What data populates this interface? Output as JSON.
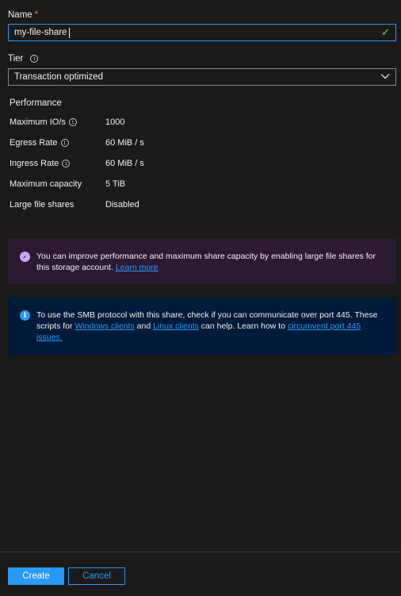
{
  "name_field": {
    "label": "Name",
    "required_marker": "*",
    "value": "my-file-share",
    "valid_icon": "checkmark-icon"
  },
  "tier_field": {
    "label": "Tier",
    "info_icon": "info-icon",
    "selected": "Transaction optimized",
    "dropdown_icon": "chevron-down-icon"
  },
  "performance": {
    "title": "Performance",
    "rows": [
      {
        "label": "Maximum IO/s",
        "value": "1000",
        "has_info": true
      },
      {
        "label": "Egress Rate",
        "value": "60 MiB / s",
        "has_info": true
      },
      {
        "label": "Ingress Rate",
        "value": "60 MiB / s",
        "has_info": true
      },
      {
        "label": "Maximum capacity",
        "value": "5 TiB",
        "has_info": false
      },
      {
        "label": "Large file shares",
        "value": "Disabled",
        "has_info": false
      }
    ]
  },
  "notice_large_shares": {
    "icon": "rocket-icon",
    "text": "You can improve performance and maximum share capacity by enabling large file shares for this storage account.",
    "link": "Learn more",
    "color": "#2a1a34"
  },
  "notice_smb": {
    "icon": "info-icon",
    "text_1": "To use the SMB protocol with this share, check if you can communicate over port 445. These scripts for",
    "link_1": "Windows clients",
    "text_2": "and",
    "link_2": "Linux clients",
    "text_3": "can help. Learn how to",
    "link_3": "circumvent port 445 issues.",
    "color": "#001a39"
  },
  "footer": {
    "create_label": "Create",
    "cancel_label": "Cancel",
    "accent": "#2899f5"
  }
}
